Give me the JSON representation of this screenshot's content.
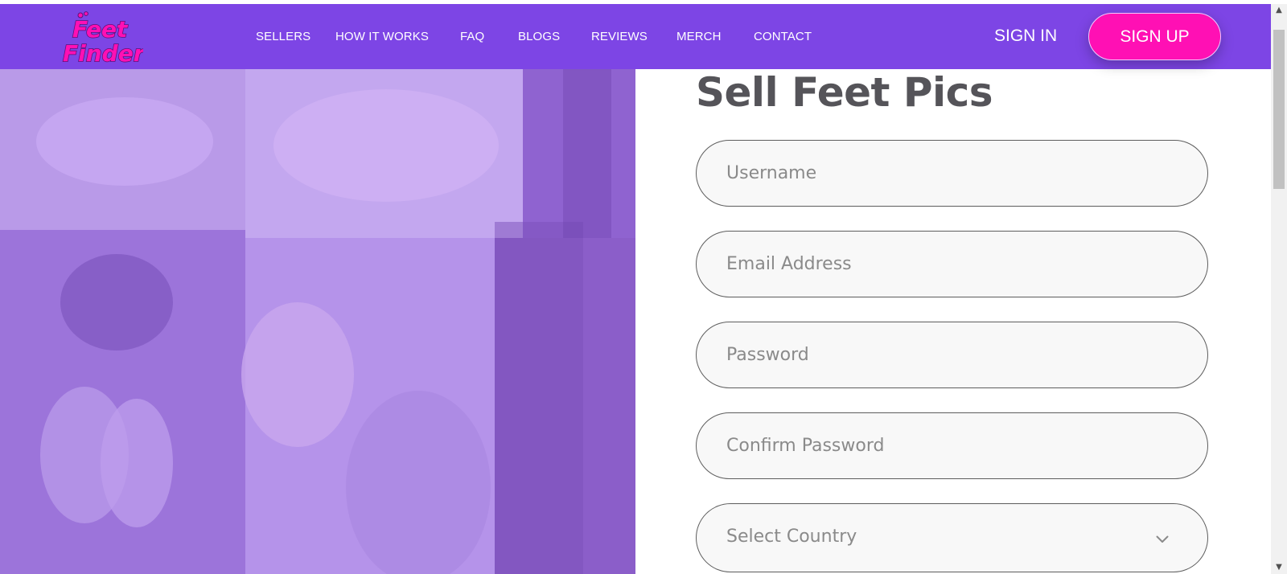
{
  "brand": {
    "name_line1": "Feet",
    "name_line2": "Finder",
    "logo_color": "#ff10b4"
  },
  "colors": {
    "nav_bg": "#7d45e5",
    "accent": "#ff10b4",
    "title": "#555459"
  },
  "nav": {
    "items": [
      {
        "label": "SELLERS"
      },
      {
        "label": "HOW IT WORKS"
      },
      {
        "label": "FAQ"
      },
      {
        "label": "BLOGS"
      },
      {
        "label": "REVIEWS"
      },
      {
        "label": "MERCH"
      },
      {
        "label": "CONTACT"
      }
    ],
    "sign_in": "SIGN IN",
    "sign_up": "SIGN UP"
  },
  "form": {
    "title": "Sell Feet Pics",
    "username_placeholder": "Username",
    "email_placeholder": "Email Address",
    "password_placeholder": "Password",
    "confirm_password_placeholder": "Confirm Password",
    "country_label": "Select Country"
  },
  "icons": {
    "chevron": "chevron-down-icon",
    "scroll_up": "arrow-up-icon",
    "scroll_down": "arrow-down-icon"
  }
}
